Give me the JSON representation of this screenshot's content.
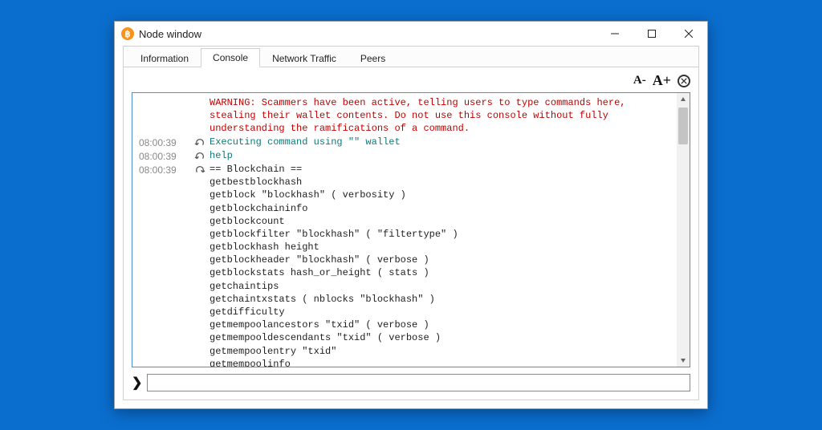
{
  "window": {
    "title": "Node window",
    "icon": "bitcoin-icon"
  },
  "tabs": [
    {
      "label": "Information",
      "active": false
    },
    {
      "label": "Console",
      "active": true
    },
    {
      "label": "Network Traffic",
      "active": false
    },
    {
      "label": "Peers",
      "active": false
    }
  ],
  "toolbar": {
    "font_minus": "A-",
    "font_plus": "A+"
  },
  "console": {
    "warning": "WARNING: Scammers have been active, telling users to type commands here, stealing their wallet contents. Do not use this console without fully understanding the ramifications of a command.",
    "rows": [
      {
        "ts": "08:00:39",
        "dir": "out",
        "text": "Executing command using \"\" wallet",
        "cls": "teal"
      },
      {
        "ts": "08:00:39",
        "dir": "out",
        "text": "help",
        "cls": "teal"
      },
      {
        "ts": "08:00:39",
        "dir": "in",
        "text": "== Blockchain ==\ngetbestblockhash\ngetblock \"blockhash\" ( verbosity )\ngetblockchaininfo\ngetblockcount\ngetblockfilter \"blockhash\" ( \"filtertype\" )\ngetblockhash height\ngetblockheader \"blockhash\" ( verbose )\ngetblockstats hash_or_height ( stats )\ngetchaintips\ngetchaintxstats ( nblocks \"blockhash\" )\ngetdifficulty\ngetmempoolancestors \"txid\" ( verbose )\ngetmempooldescendants \"txid\" ( verbose )\ngetmempoolentry \"txid\"\ngetmempoolinfo",
        "cls": "body"
      }
    ]
  },
  "input": {
    "prompt": "❯",
    "value": ""
  }
}
